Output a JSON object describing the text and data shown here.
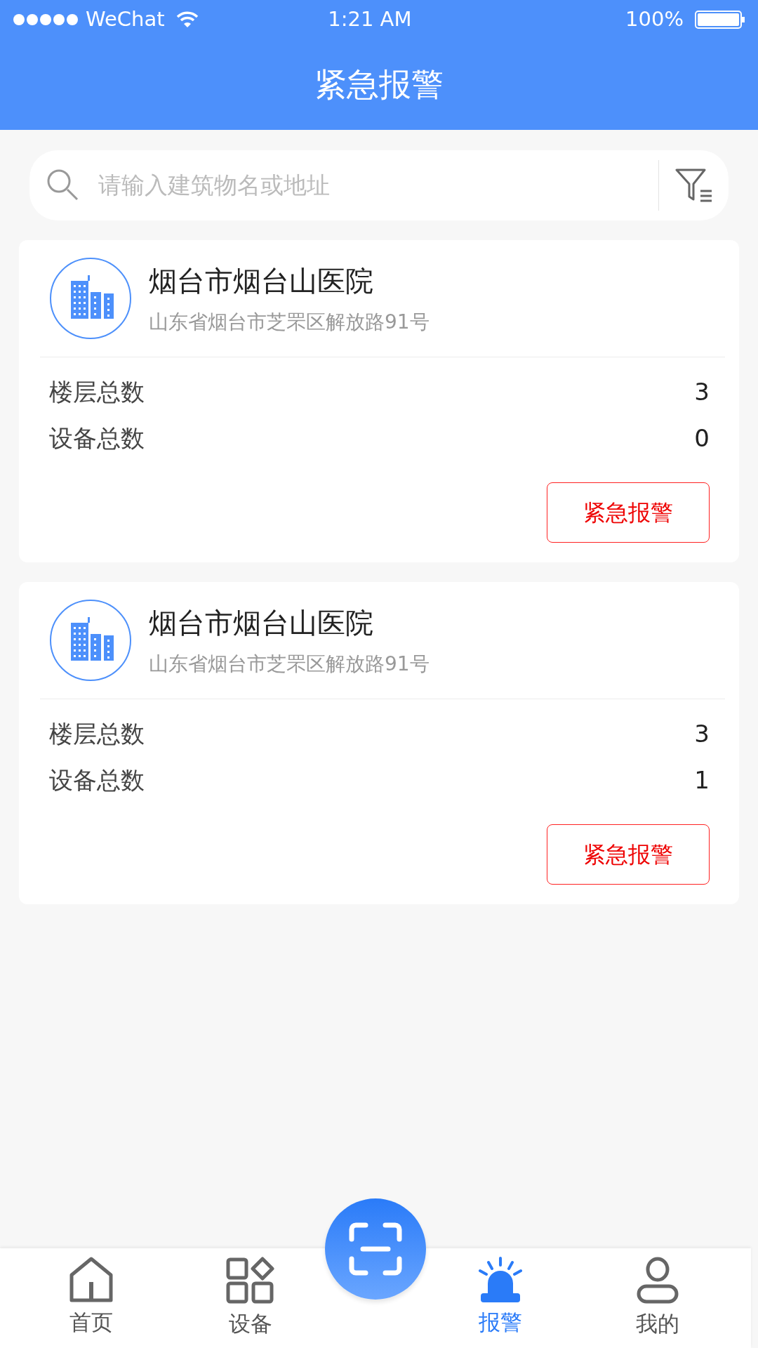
{
  "status_bar": {
    "carrier": "WeChat",
    "time": "1:21 AM",
    "battery": "100%"
  },
  "header": {
    "title": "紧急报警"
  },
  "search": {
    "placeholder": "请输入建筑物名或地址"
  },
  "buildings": [
    {
      "name": "烟台市烟台山医院",
      "address": "山东省烟台市芝罘区解放路91号",
      "stats": [
        {
          "label": "楼层总数",
          "value": "3"
        },
        {
          "label": "设备总数",
          "value": "0"
        }
      ],
      "button": "紧急报警"
    },
    {
      "name": "烟台市烟台山医院",
      "address": "山东省烟台市芝罘区解放路91号",
      "stats": [
        {
          "label": "楼层总数",
          "value": "3"
        },
        {
          "label": "设备总数",
          "value": "1"
        }
      ],
      "button": "紧急报警"
    }
  ],
  "tabs": [
    {
      "kind": "home",
      "label": "首页",
      "selected": false
    },
    {
      "kind": "grid",
      "label": "设备",
      "selected": false
    },
    {
      "kind": "alarm",
      "label": "报警",
      "selected": true
    },
    {
      "kind": "user",
      "label": "我的",
      "selected": false
    }
  ]
}
